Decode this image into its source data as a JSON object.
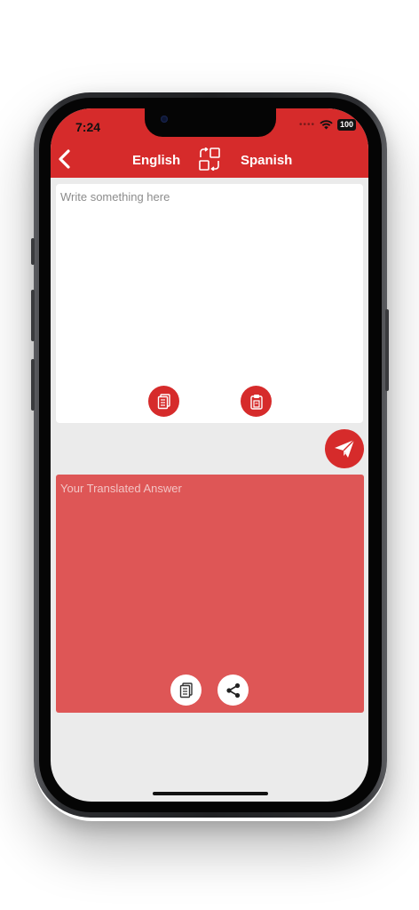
{
  "status_bar": {
    "time": "7:24",
    "signal_dots": "••••",
    "battery": "100"
  },
  "header": {
    "source_language": "English",
    "target_language": "Spanish"
  },
  "input": {
    "placeholder": "Write something here"
  },
  "output": {
    "placeholder": "Your Translated Answer"
  },
  "colors": {
    "accent": "#d62b2b",
    "output_bg": "#de5656",
    "screen_bg": "#ebebeb"
  },
  "icons": {
    "back": "chevron-left-icon",
    "swap": "swap-languages-icon",
    "copy": "copy-icon",
    "paste": "paste-icon",
    "send": "paper-plane-icon",
    "share": "share-icon"
  }
}
